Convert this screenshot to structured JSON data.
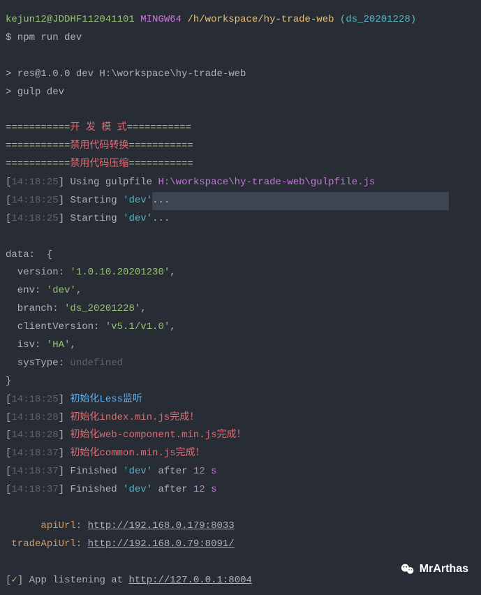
{
  "prompt": {
    "user": "kejun12@JDDHF112041101",
    "shell": "MINGW64",
    "path": "/h/workspace/hy-trade-web",
    "branch": "ds_20201228"
  },
  "cmd": "$ npm run dev",
  "script1": "> res@1.0.0 dev H:\\workspace\\hy-trade-web",
  "script2": "> gulp dev",
  "banner1_pre": "===========",
  "banner1_txt": "开 发 模 式",
  "banner1_post": "===========",
  "banner2_pre": "===========",
  "banner2_txt": "禁用代码转换",
  "banner2_post": "===========",
  "banner3_pre": "===========",
  "banner3_txt": "禁用代码压缩",
  "banner3_post": "===========",
  "t1": "14:18:25",
  "t2": "14:18:28",
  "t3": "14:18:37",
  "usingGulpfile": "Using gulpfile",
  "gulpfilePath": "H:\\workspace\\hy-trade-web\\gulpfile.js",
  "starting": "Starting",
  "taskName": "'dev'",
  "ellipsis": "...",
  "dataHeader": "data:  {",
  "version_k": "  version:",
  "version_v": "'1.0.10.20201230'",
  "env_k": "  env:",
  "env_v": "'dev'",
  "branch_k": "  branch:",
  "branch_v": "'ds_20201228'",
  "clientVersion_k": "  clientVersion:",
  "clientVersion_v": "'v5.1/v1.0'",
  "isv_k": "  isv:",
  "isv_v": "'HA'",
  "sysType_k": "  sysType:",
  "sysType_v": "undefined",
  "dataFooter": "}",
  "lessInit": "初始化Less监听",
  "indexInit": "初始化index.min.js完成！",
  "webCompInit": "初始化web-component.min.js完成！",
  "commonInit": "初始化common.min.js完成！",
  "finished": "Finished",
  "after": "after",
  "duration": "12",
  "durationUnit": "s",
  "apiUrlLabel": "apiUrl:",
  "apiUrl": "http://192.168.0.179:8033",
  "tradeApiUrlLabel": "tradeApiUrl:",
  "tradeApiUrl": "http://192.168.0.79:8091/",
  "check": "✓",
  "listening": "App listening at",
  "listenUrl": "http://127.0.0.1:8004",
  "watermark": "MrArthas",
  "comma": ",",
  "lb": "[",
  "rb": "] ",
  "lp": " (",
  "rp": ")"
}
